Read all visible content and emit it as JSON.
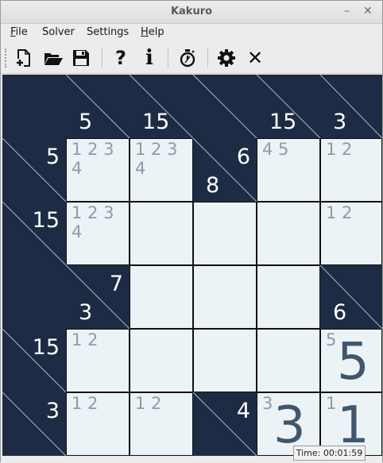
{
  "window": {
    "title": "Kakuro",
    "minimize_glyph": "–",
    "close_glyph": "✕"
  },
  "menu": {
    "items": [
      {
        "label": "File",
        "mnemonic": "F",
        "rest": "ile"
      },
      {
        "label": "Solver",
        "mnemonic": "",
        "rest": "Solver"
      },
      {
        "label": "Settings",
        "mnemonic": "",
        "rest": "Settings"
      },
      {
        "label": "Help",
        "mnemonic": "H",
        "rest": "elp"
      }
    ]
  },
  "toolbar": {
    "icons": [
      "new-icon",
      "open-icon",
      "save-icon",
      "help-icon",
      "info-icon",
      "solver-timer-icon",
      "settings-icon",
      "close-icon"
    ],
    "help_glyph": "?",
    "info_glyph": "i",
    "close_glyph": "✕"
  },
  "colors": {
    "board_background": "#1d2c44",
    "white_cell": "#ecf3f6",
    "candidate_text": "#8d9ba8",
    "entered_value": "#40576b",
    "clue_text": "#ffffff"
  },
  "board": {
    "rows": 6,
    "cols": 6,
    "cells": [
      [
        {
          "type": "black"
        },
        {
          "type": "black",
          "diag": true,
          "down": "5"
        },
        {
          "type": "black",
          "diag": true,
          "down": "15"
        },
        {
          "type": "black",
          "diag": true
        },
        {
          "type": "black",
          "diag": true,
          "down": "15"
        },
        {
          "type": "black",
          "diag": true,
          "down": "3"
        }
      ],
      [
        {
          "type": "black",
          "diag": true,
          "across": "5"
        },
        {
          "type": "white",
          "cand1": "1 2 3",
          "cand2": "4"
        },
        {
          "type": "white",
          "cand1": "1 2 3",
          "cand2": "4"
        },
        {
          "type": "black",
          "diag": true,
          "across": "6",
          "down": "8"
        },
        {
          "type": "white",
          "cand1": "4 5",
          "cand2": ""
        },
        {
          "type": "white",
          "cand1": "1 2",
          "cand2": ""
        }
      ],
      [
        {
          "type": "black",
          "diag": true,
          "across": "15"
        },
        {
          "type": "white",
          "cand1": "1 2 3",
          "cand2": "4"
        },
        {
          "type": "white"
        },
        {
          "type": "white"
        },
        {
          "type": "white"
        },
        {
          "type": "white",
          "cand1": "1 2",
          "cand2": ""
        }
      ],
      [
        {
          "type": "black"
        },
        {
          "type": "black",
          "diag": true,
          "across": "7",
          "down": "3"
        },
        {
          "type": "white"
        },
        {
          "type": "white"
        },
        {
          "type": "white"
        },
        {
          "type": "black",
          "diag": true,
          "down": "6"
        }
      ],
      [
        {
          "type": "black",
          "diag": true,
          "across": "15"
        },
        {
          "type": "white",
          "cand1": "1 2",
          "cand2": ""
        },
        {
          "type": "white"
        },
        {
          "type": "white"
        },
        {
          "type": "white"
        },
        {
          "type": "white",
          "small": "5",
          "value": "5"
        }
      ],
      [
        {
          "type": "black",
          "diag": true,
          "across": "3"
        },
        {
          "type": "white",
          "cand1": "1 2",
          "cand2": ""
        },
        {
          "type": "white",
          "cand1": "1 2",
          "cand2": ""
        },
        {
          "type": "black",
          "diag": true,
          "across": "4"
        },
        {
          "type": "white",
          "small": "3",
          "value": "3"
        },
        {
          "type": "white",
          "small": "1",
          "value": "1"
        }
      ]
    ]
  },
  "status": {
    "timer": "Time: 00:01:59"
  }
}
